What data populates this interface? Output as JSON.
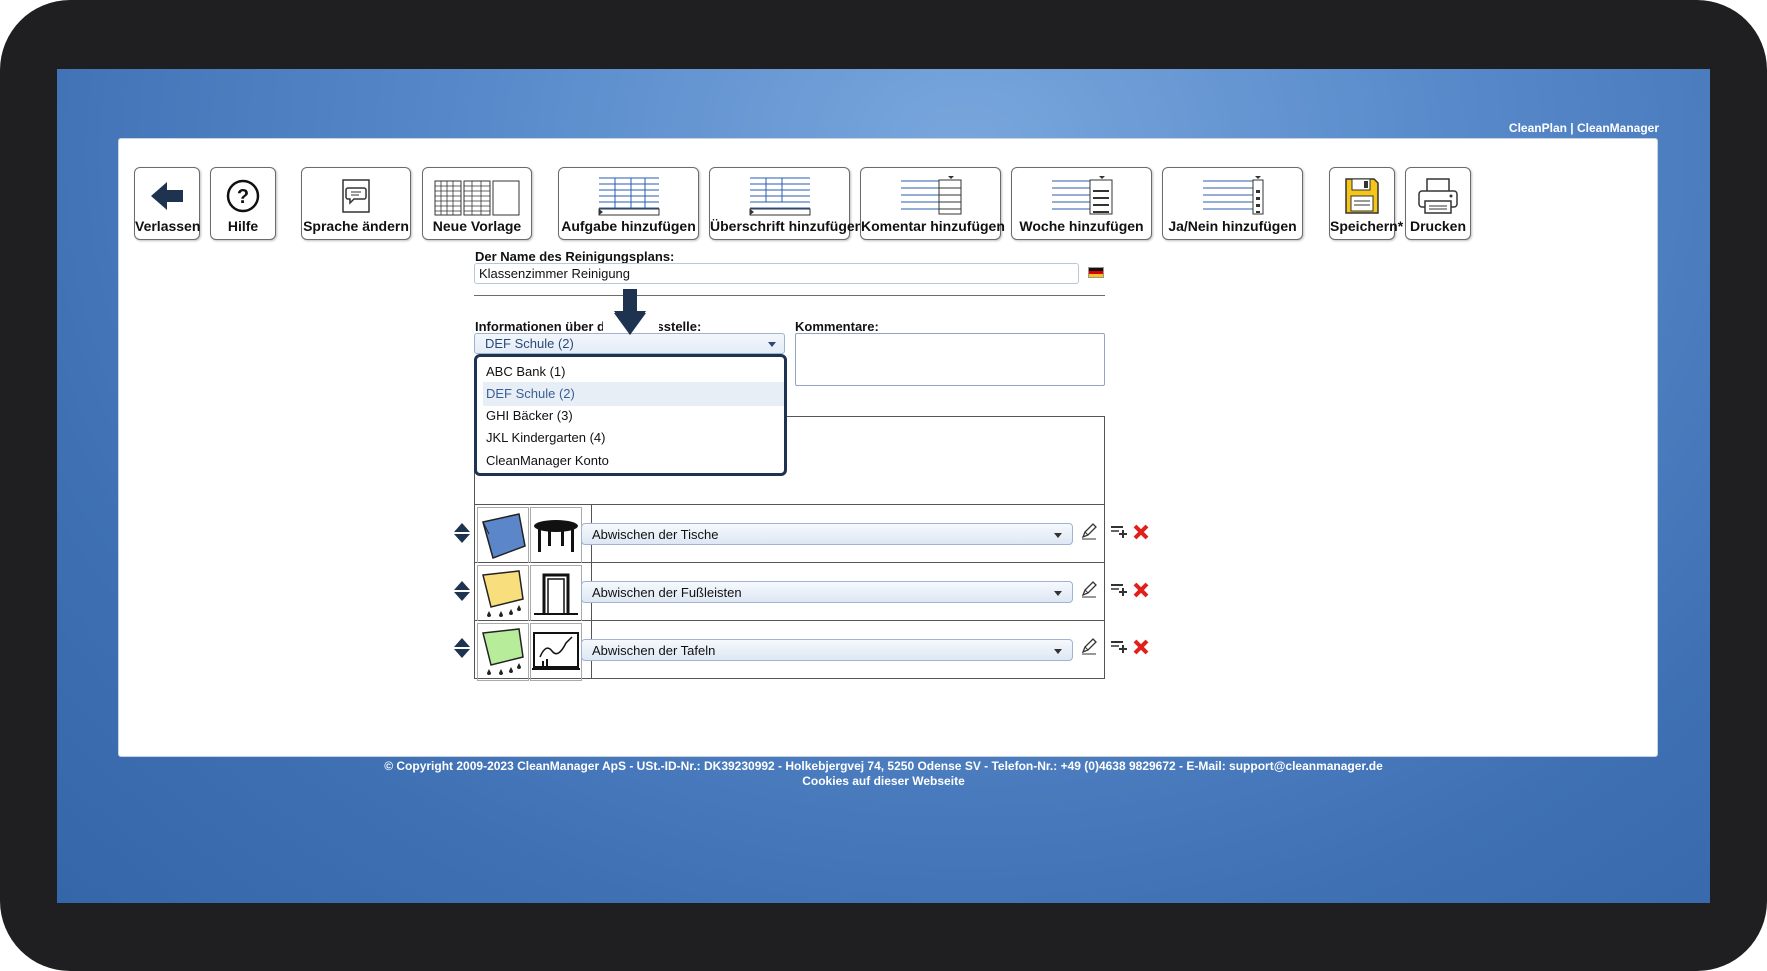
{
  "app": {
    "brand": "CleanPlan | CleanManager"
  },
  "toolbar": {
    "buttons": [
      {
        "label": "Verlassen",
        "icon": "back-arrow-icon"
      },
      {
        "label": "Hilfe",
        "icon": "help-icon"
      },
      {
        "label": "Sprache ändern",
        "icon": "speech-bubble-icon"
      },
      {
        "label": "Neue Vorlage",
        "icon": "template-grid-icon"
      },
      {
        "label": "Aufgabe hinzufügen",
        "icon": "add-task-table-icon"
      },
      {
        "label": "Überschrift hinzufügen",
        "icon": "add-heading-table-icon"
      },
      {
        "label": "Komentar hinzufügen",
        "icon": "add-comment-table-icon"
      },
      {
        "label": "Woche hinzufügen",
        "icon": "add-week-table-icon"
      },
      {
        "label": "Ja/Nein hinzufügen",
        "icon": "add-yes-no-table-icon"
      },
      {
        "label": "Speichern*",
        "icon": "floppy-disk-icon"
      },
      {
        "label": "Drucken",
        "icon": "printer-icon"
      }
    ]
  },
  "form": {
    "name_label": "Der Name des Reinigungsplans:",
    "name_value": "Klassenzimmer Reinigung",
    "location_label": "Informationen über die Arbeitsstelle:",
    "location_selected": "DEF Schule (2)",
    "comments_label": "Kommentare:",
    "location_options": [
      "ABC Bank (1)",
      "DEF Schule (2)",
      "GHI Bäcker (3)",
      "JKL Kindergarten (4)",
      "CleanManager Konto"
    ]
  },
  "tasks": [
    {
      "name": "Abwischen der Tische",
      "icons": [
        "blue-cloth-icon",
        "table-icon"
      ]
    },
    {
      "name": "Abwischen der Fußleisten",
      "icons": [
        "yellow-wet-cloth-icon",
        "doorframe-icon"
      ]
    },
    {
      "name": "Abwischen der Tafeln",
      "icons": [
        "green-wet-cloth-icon",
        "blackboard-icon"
      ]
    }
  ],
  "footer": {
    "copyright": "© Copyright 2009-2023 CleanManager ApS - USt.-ID-Nr.: DK39230992 - Holkebjergvej 74, 5250 Odense SV - Telefon-Nr.: +49 (0)4638 9829672 - E-Mail: support@cleanmanager.de",
    "cookies": "Cookies auf dieser Webseite"
  },
  "colors": {
    "background_blue": "#5a8ccc",
    "delete_red": "#e0201b",
    "dropdown_border": "#1e3350",
    "selected_option": "#3a5f95"
  }
}
